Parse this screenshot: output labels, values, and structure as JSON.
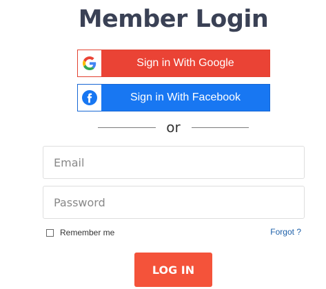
{
  "page": {
    "title": "Member Login"
  },
  "social": {
    "google_label": "Sign in With Google",
    "facebook_label": "Sign in With Facebook",
    "google_icon": "google-icon",
    "facebook_icon": "facebook-icon",
    "google_color": "#ea4335",
    "facebook_color": "#1877f2"
  },
  "divider": {
    "text": "or"
  },
  "form": {
    "email_placeholder": "Email",
    "password_placeholder": "Password",
    "remember_label": "Remember me",
    "remember_checked": false,
    "forgot_label": "Forgot ?",
    "login_label": "LOG IN",
    "login_color": "#f4533a"
  }
}
